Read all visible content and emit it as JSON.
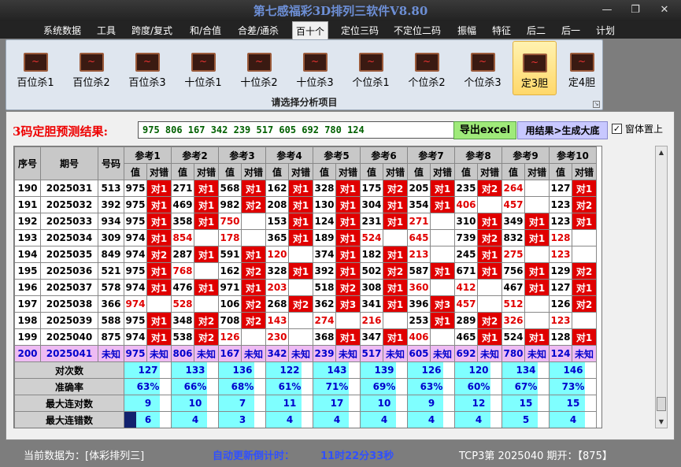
{
  "window": {
    "title": "第七感福彩3D排列三软件V8.80",
    "min_icon": "minimize-icon",
    "max_icon": "restore-icon",
    "close_icon": "close-icon"
  },
  "menu": [
    "系统数据",
    "工具",
    "跨度/复式",
    "和/合值",
    "合差/通杀",
    "百十个",
    "定位三码",
    "不定位二码",
    "振幅",
    "特征",
    "后二",
    "后一",
    "计划"
  ],
  "menu_active": "百十个",
  "ribbon": {
    "buttons": [
      "百位杀1",
      "百位杀2",
      "百位杀3",
      "十位杀1",
      "十位杀2",
      "十位杀3",
      "个位杀1",
      "个位杀2",
      "个位杀3",
      "定3胆",
      "定4胆"
    ],
    "selected": "定3胆",
    "group_label": "请选择分析项目"
  },
  "prediction": {
    "label": "3码定胆预测结果:",
    "value": "975 806 167 342 239 517 605 692 780 124",
    "export_label": "导出excel",
    "generate_label": "用结果>生成大底",
    "topmost_label": "窗体置上",
    "topmost_checked": true
  },
  "table": {
    "headers": {
      "index": "序号",
      "period": "期号",
      "number": "号码",
      "ref_value": "值",
      "ref_hit": "对错"
    },
    "refs": [
      "参考1",
      "参考2",
      "参考3",
      "参考4",
      "参考5",
      "参考6",
      "参考7",
      "参考8",
      "参考9",
      "参考10"
    ],
    "rows": [
      {
        "idx": "190",
        "period": "2025031",
        "num": "513",
        "cells": [
          [
            "975",
            "对1"
          ],
          [
            "271",
            "对1"
          ],
          [
            "568",
            "对1"
          ],
          [
            "162",
            "对1"
          ],
          [
            "328",
            "对1"
          ],
          [
            "175",
            "对2"
          ],
          [
            "205",
            "对1"
          ],
          [
            "235",
            "对2"
          ],
          [
            "264",
            ""
          ],
          [
            "127",
            "对1"
          ]
        ]
      },
      {
        "idx": "191",
        "period": "2025032",
        "num": "392",
        "cells": [
          [
            "975",
            "对1"
          ],
          [
            "469",
            "对1"
          ],
          [
            "982",
            "对2"
          ],
          [
            "208",
            "对1"
          ],
          [
            "130",
            "对1"
          ],
          [
            "304",
            "对1"
          ],
          [
            "354",
            "对1"
          ],
          [
            "406",
            ""
          ],
          [
            "457",
            ""
          ],
          [
            "123",
            "对2"
          ]
        ]
      },
      {
        "idx": "192",
        "period": "2025033",
        "num": "934",
        "cells": [
          [
            "975",
            "对1"
          ],
          [
            "358",
            "对1"
          ],
          [
            "750",
            ""
          ],
          [
            "153",
            "对1"
          ],
          [
            "124",
            "对1"
          ],
          [
            "231",
            "对1"
          ],
          [
            "271",
            ""
          ],
          [
            "310",
            "对1"
          ],
          [
            "349",
            "对1"
          ],
          [
            "123",
            "对1"
          ]
        ]
      },
      {
        "idx": "193",
        "period": "2025034",
        "num": "309",
        "cells": [
          [
            "974",
            "对1"
          ],
          [
            "854",
            ""
          ],
          [
            "178",
            ""
          ],
          [
            "365",
            "对1"
          ],
          [
            "189",
            "对1"
          ],
          [
            "524",
            ""
          ],
          [
            "645",
            ""
          ],
          [
            "739",
            "对2"
          ],
          [
            "832",
            "对1"
          ],
          [
            "128",
            ""
          ]
        ]
      },
      {
        "idx": "194",
        "period": "2025035",
        "num": "849",
        "cells": [
          [
            "974",
            "对2"
          ],
          [
            "287",
            "对1"
          ],
          [
            "591",
            "对1"
          ],
          [
            "120",
            ""
          ],
          [
            "374",
            "对1"
          ],
          [
            "182",
            "对1"
          ],
          [
            "213",
            ""
          ],
          [
            "245",
            "对1"
          ],
          [
            "275",
            ""
          ],
          [
            "123",
            ""
          ]
        ]
      },
      {
        "idx": "195",
        "period": "2025036",
        "num": "521",
        "cells": [
          [
            "975",
            "对1"
          ],
          [
            "768",
            ""
          ],
          [
            "162",
            "对2"
          ],
          [
            "328",
            "对1"
          ],
          [
            "392",
            "对1"
          ],
          [
            "502",
            "对2"
          ],
          [
            "587",
            "对1"
          ],
          [
            "671",
            "对1"
          ],
          [
            "756",
            "对1"
          ],
          [
            "129",
            "对2"
          ]
        ]
      },
      {
        "idx": "196",
        "period": "2025037",
        "num": "578",
        "cells": [
          [
            "974",
            "对1"
          ],
          [
            "476",
            "对1"
          ],
          [
            "971",
            "对1"
          ],
          [
            "203",
            ""
          ],
          [
            "518",
            "对2"
          ],
          [
            "308",
            "对1"
          ],
          [
            "360",
            ""
          ],
          [
            "412",
            ""
          ],
          [
            "467",
            "对1"
          ],
          [
            "127",
            "对1"
          ]
        ]
      },
      {
        "idx": "197",
        "period": "2025038",
        "num": "366",
        "cells": [
          [
            "974",
            ""
          ],
          [
            "528",
            ""
          ],
          [
            "106",
            "对2"
          ],
          [
            "268",
            "对2"
          ],
          [
            "362",
            "对3"
          ],
          [
            "341",
            "对1"
          ],
          [
            "396",
            "对3"
          ],
          [
            "457",
            ""
          ],
          [
            "512",
            ""
          ],
          [
            "126",
            "对2"
          ]
        ]
      },
      {
        "idx": "198",
        "period": "2025039",
        "num": "588",
        "cells": [
          [
            "975",
            "对1"
          ],
          [
            "348",
            "对2"
          ],
          [
            "708",
            "对2"
          ],
          [
            "143",
            ""
          ],
          [
            "274",
            ""
          ],
          [
            "216",
            ""
          ],
          [
            "253",
            "对1"
          ],
          [
            "289",
            "对2"
          ],
          [
            "326",
            ""
          ],
          [
            "123",
            ""
          ]
        ]
      },
      {
        "idx": "199",
        "period": "2025040",
        "num": "875",
        "cells": [
          [
            "974",
            "对1"
          ],
          [
            "538",
            "对2"
          ],
          [
            "126",
            ""
          ],
          [
            "230",
            ""
          ],
          [
            "368",
            "对1"
          ],
          [
            "347",
            "对1"
          ],
          [
            "406",
            ""
          ],
          [
            "465",
            "对1"
          ],
          [
            "524",
            "对1"
          ],
          [
            "128",
            "对1"
          ]
        ]
      }
    ],
    "pred_row": {
      "idx": "200",
      "period": "2025041",
      "num": "未知",
      "cells": [
        [
          "975",
          "未知"
        ],
        [
          "806",
          "未知"
        ],
        [
          "167",
          "未知"
        ],
        [
          "342",
          "未知"
        ],
        [
          "239",
          "未知"
        ],
        [
          "517",
          "未知"
        ],
        [
          "605",
          "未知"
        ],
        [
          "692",
          "未知"
        ],
        [
          "780",
          "未知"
        ],
        [
          "124",
          "未知"
        ]
      ]
    },
    "stats": [
      {
        "label": "对次数",
        "values": [
          "127",
          "133",
          "136",
          "122",
          "143",
          "139",
          "126",
          "120",
          "134",
          "146"
        ]
      },
      {
        "label": "准确率",
        "values": [
          "63%",
          "66%",
          "68%",
          "61%",
          "71%",
          "69%",
          "63%",
          "60%",
          "67%",
          "73%"
        ]
      },
      {
        "label": "最大连对数",
        "values": [
          "9",
          "10",
          "7",
          "11",
          "17",
          "10",
          "9",
          "12",
          "15",
          "15"
        ]
      },
      {
        "label": "最大连错数",
        "values": [
          "6",
          "4",
          "3",
          "4",
          "4",
          "4",
          "4",
          "4",
          "5",
          "4"
        ]
      }
    ]
  },
  "colors": {
    "hit": "#e00000",
    "miss_value": "#e00000",
    "predict_row": "#eebbf3",
    "stat_value_bg": "#7fffff",
    "title": "#6d8fd6"
  },
  "status": {
    "current_data": "当前数据为：[体彩排列三]",
    "countdown_label": "自动更新倒计时：",
    "countdown_value": "11时22分33秒",
    "latest": "TCP3第 2025040 期开：【875】"
  }
}
